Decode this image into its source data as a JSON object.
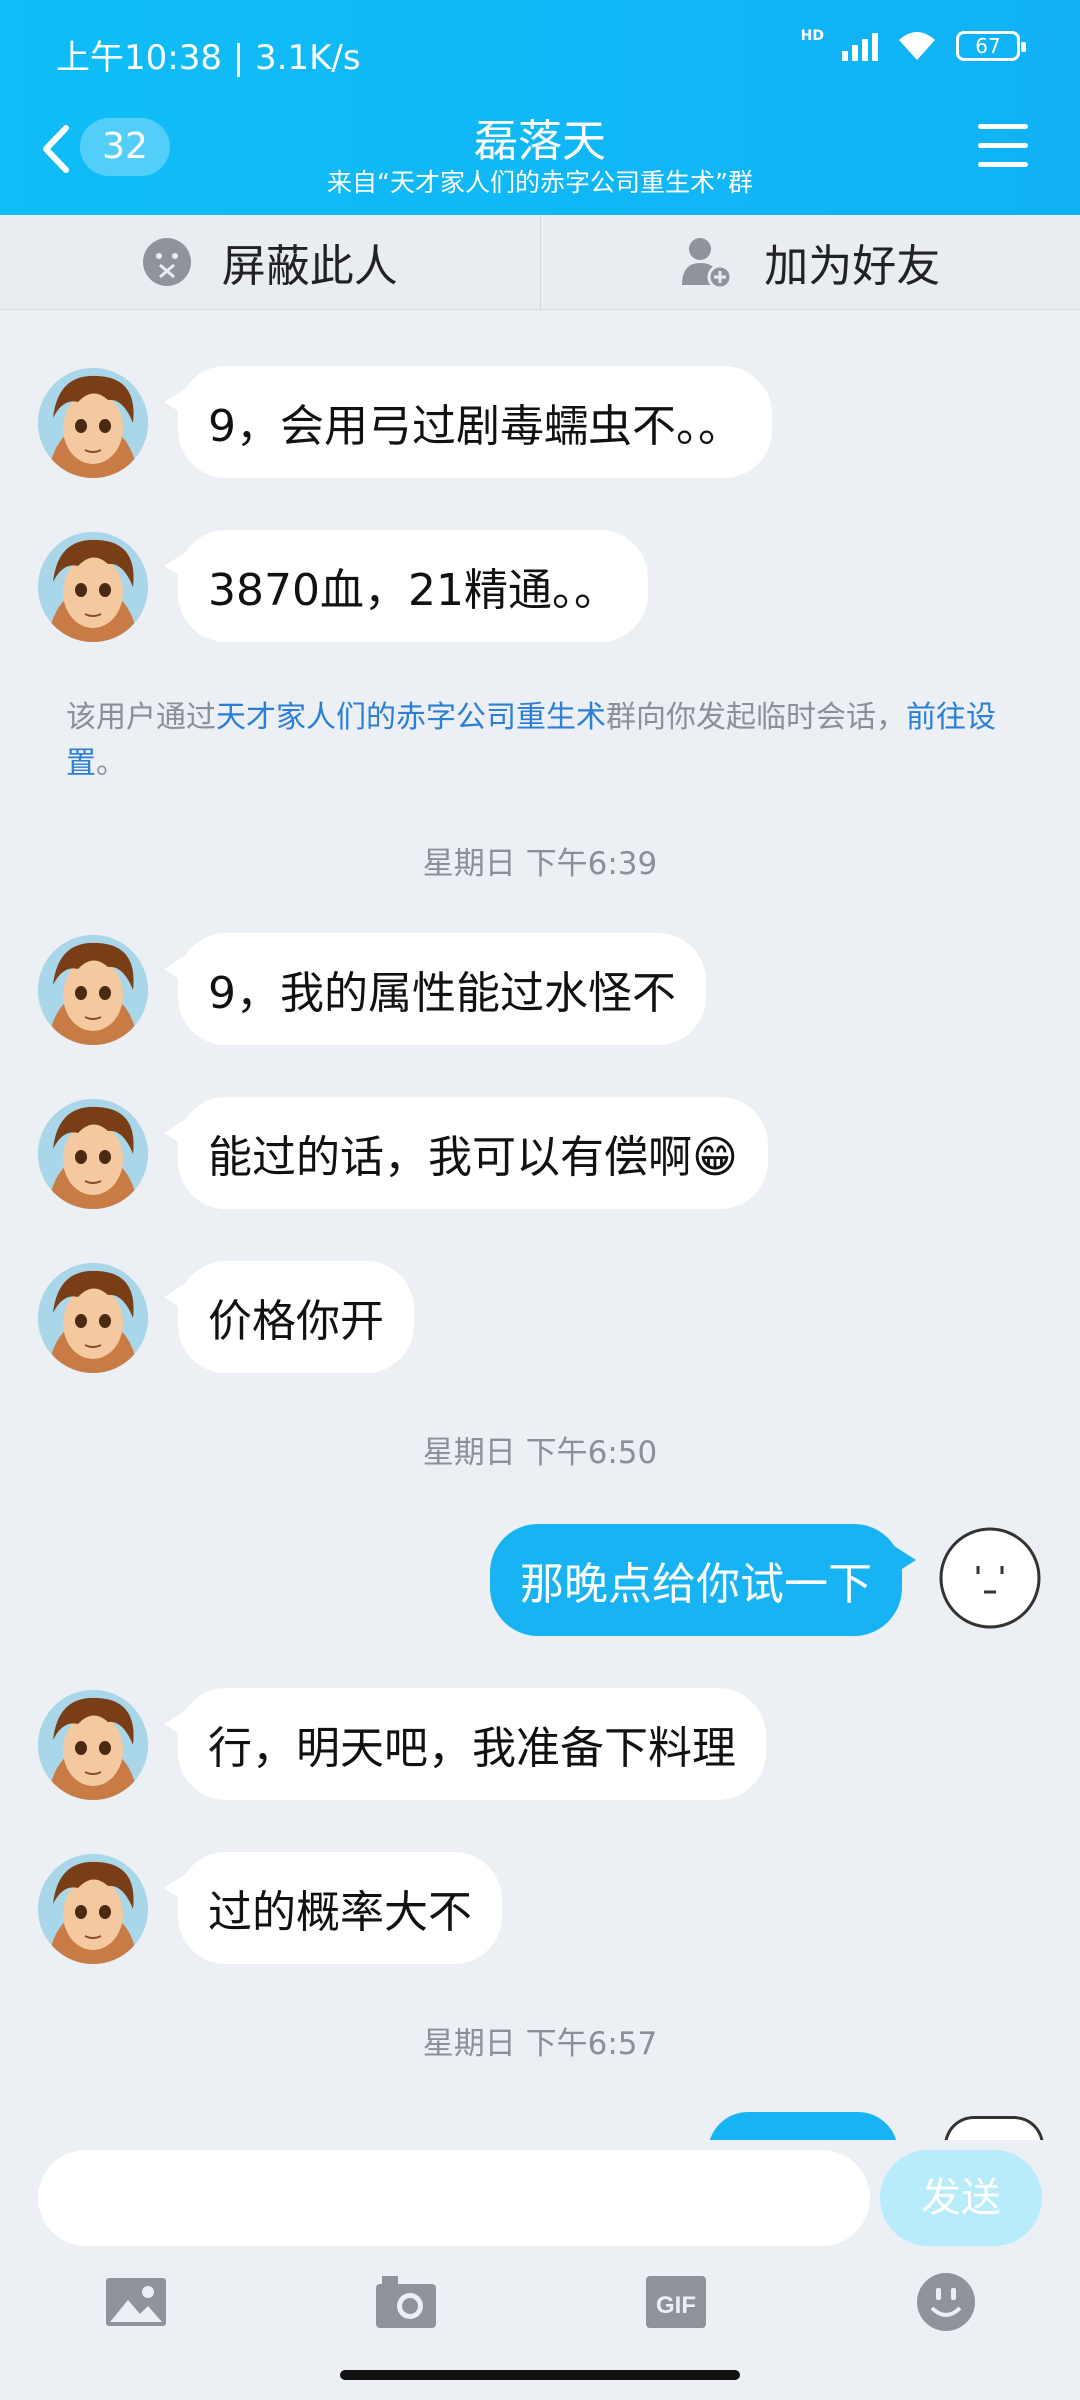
{
  "status": {
    "time": "上午10:38 | 3.1K/s",
    "hd": "HD",
    "battery": "67"
  },
  "header": {
    "back_count": "32",
    "title": "磊落天",
    "subtitle": "来自“天才家人们的赤字公司重生术”群"
  },
  "actions": {
    "block": "屏蔽此人",
    "add_friend": "加为好友"
  },
  "messages": [
    {
      "text": "9，会用弓过剧毒蠕虫不。。"
    },
    {
      "text": "3870血，21精通。。"
    },
    {
      "text": "9，我的属性能过水怪不"
    },
    {
      "text": "能过的话，我可以有偿啊😁"
    },
    {
      "text": "价格你开"
    },
    {
      "text": "那晚点给你试一下"
    },
    {
      "text": "行，明天吧，我准备下料理"
    },
    {
      "text": "过的概率大不"
    }
  ],
  "notice": {
    "prefix": "该用户通过",
    "group": "天才家人们的赤字公司重生术",
    "middle": "群向你发起临时会话，",
    "link": "前往设置",
    "suffix": "。"
  },
  "timestamps": [
    "星期日 下午6:39",
    "星期日 下午6:50",
    "星期日 下午6:57"
  ],
  "input": {
    "send_label": "发送"
  },
  "toolbar_icons": [
    "image-icon",
    "camera-icon",
    "gif-icon",
    "emoji-icon"
  ],
  "colors": {
    "header": "#10bdf6",
    "my_bubble": "#17b3f3",
    "link": "#2b7fd6"
  }
}
